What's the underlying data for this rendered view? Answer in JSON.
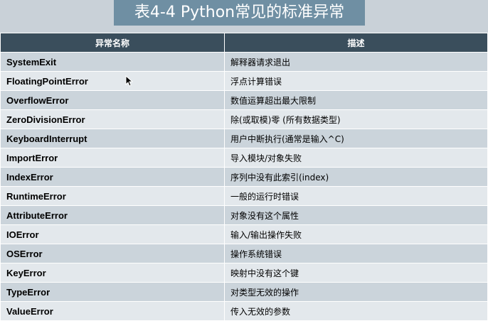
{
  "title": "表4-4 Python常见的标准异常",
  "table": {
    "headers": [
      "异常名称",
      "描述"
    ],
    "rows": [
      {
        "name": "SystemExit",
        "desc": "解释器请求退出"
      },
      {
        "name": "FloatingPointError",
        "desc": "浮点计算错误"
      },
      {
        "name": "OverflowError",
        "desc": "数值运算超出最大限制"
      },
      {
        "name": "ZeroDivisionError",
        "desc": "除(或取模)零 (所有数据类型)"
      },
      {
        "name": "KeyboardInterrupt",
        "desc": "用户中断执行(通常是输入^C)"
      },
      {
        "name": "ImportError",
        "desc": "导入模块/对象失败"
      },
      {
        "name": "IndexError",
        "desc": "序列中没有此索引(index)"
      },
      {
        "name": "RuntimeError",
        "desc": "一般的运行时错误"
      },
      {
        "name": "AttributeError",
        "desc": "对象没有这个属性"
      },
      {
        "name": "IOError",
        "desc": "输入/输出操作失败"
      },
      {
        "name": "OSError",
        "desc": "操作系统错误"
      },
      {
        "name": "KeyError",
        "desc": "映射中没有这个键"
      },
      {
        "name": "TypeError",
        "desc": "对类型无效的操作"
      },
      {
        "name": "ValueError",
        "desc": "传入无效的参数"
      }
    ]
  },
  "colors": {
    "header_bg": "#3a4e5c",
    "title_bg": "#6f8fa3",
    "row_odd": "#cbd4db",
    "row_even": "#e3e8ec"
  },
  "icons": [
    "mouse-cursor-icon"
  ]
}
